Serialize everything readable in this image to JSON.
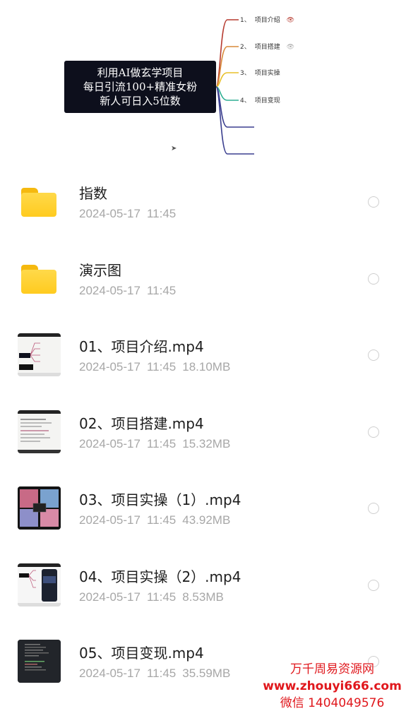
{
  "banner": {
    "title_lines": [
      "利用AI做玄学项目",
      "每日引流100+精准女粉",
      "新人可日入5位数"
    ],
    "branches": [
      {
        "num": "1、",
        "label": "项目介绍",
        "color": "#b63a2f"
      },
      {
        "num": "2、",
        "label": "项目搭建",
        "color": "#d88a3a"
      },
      {
        "num": "3、",
        "label": "项目实操",
        "color": "#e8c02a"
      },
      {
        "num": "4、",
        "label": "项目变现",
        "color": "#2fae93"
      },
      {
        "num": "",
        "label": "",
        "color": "#3b3f8f"
      },
      {
        "num": "",
        "label": "",
        "color": "#3b3f8f"
      }
    ]
  },
  "files": [
    {
      "name": "指数",
      "date": "2024-05-17",
      "time": "11:45",
      "size": "",
      "type": "folder"
    },
    {
      "name": "演示图",
      "date": "2024-05-17",
      "time": "11:45",
      "size": "",
      "type": "folder"
    },
    {
      "name": "01、项目介绍.mp4",
      "date": "2024-05-17",
      "time": "11:45",
      "size": "18.10MB",
      "type": "video-mindmap"
    },
    {
      "name": "02、项目搭建.mp4",
      "date": "2024-05-17",
      "time": "11:45",
      "size": "15.32MB",
      "type": "video-doc"
    },
    {
      "name": "03、项目实操（1）.mp4",
      "date": "2024-05-17",
      "time": "11:45",
      "size": "43.92MB",
      "type": "video-images"
    },
    {
      "name": "04、项目实操（2）.mp4",
      "date": "2024-05-17",
      "time": "11:45",
      "size": "8.53MB",
      "type": "video-app"
    },
    {
      "name": "05、项目变现.mp4",
      "date": "2024-05-17",
      "time": "11:45",
      "size": "35.59MB",
      "type": "video-code"
    }
  ],
  "watermark": {
    "line1": "万千周易资源网",
    "line2": "www.zhouyi666.com",
    "line3": "微信 1404049576",
    "color": "#e0171c"
  },
  "colors": {
    "folder": "#ffcb1f",
    "meta_text": "#a7a7a7",
    "name_text": "#1d1d1d"
  }
}
